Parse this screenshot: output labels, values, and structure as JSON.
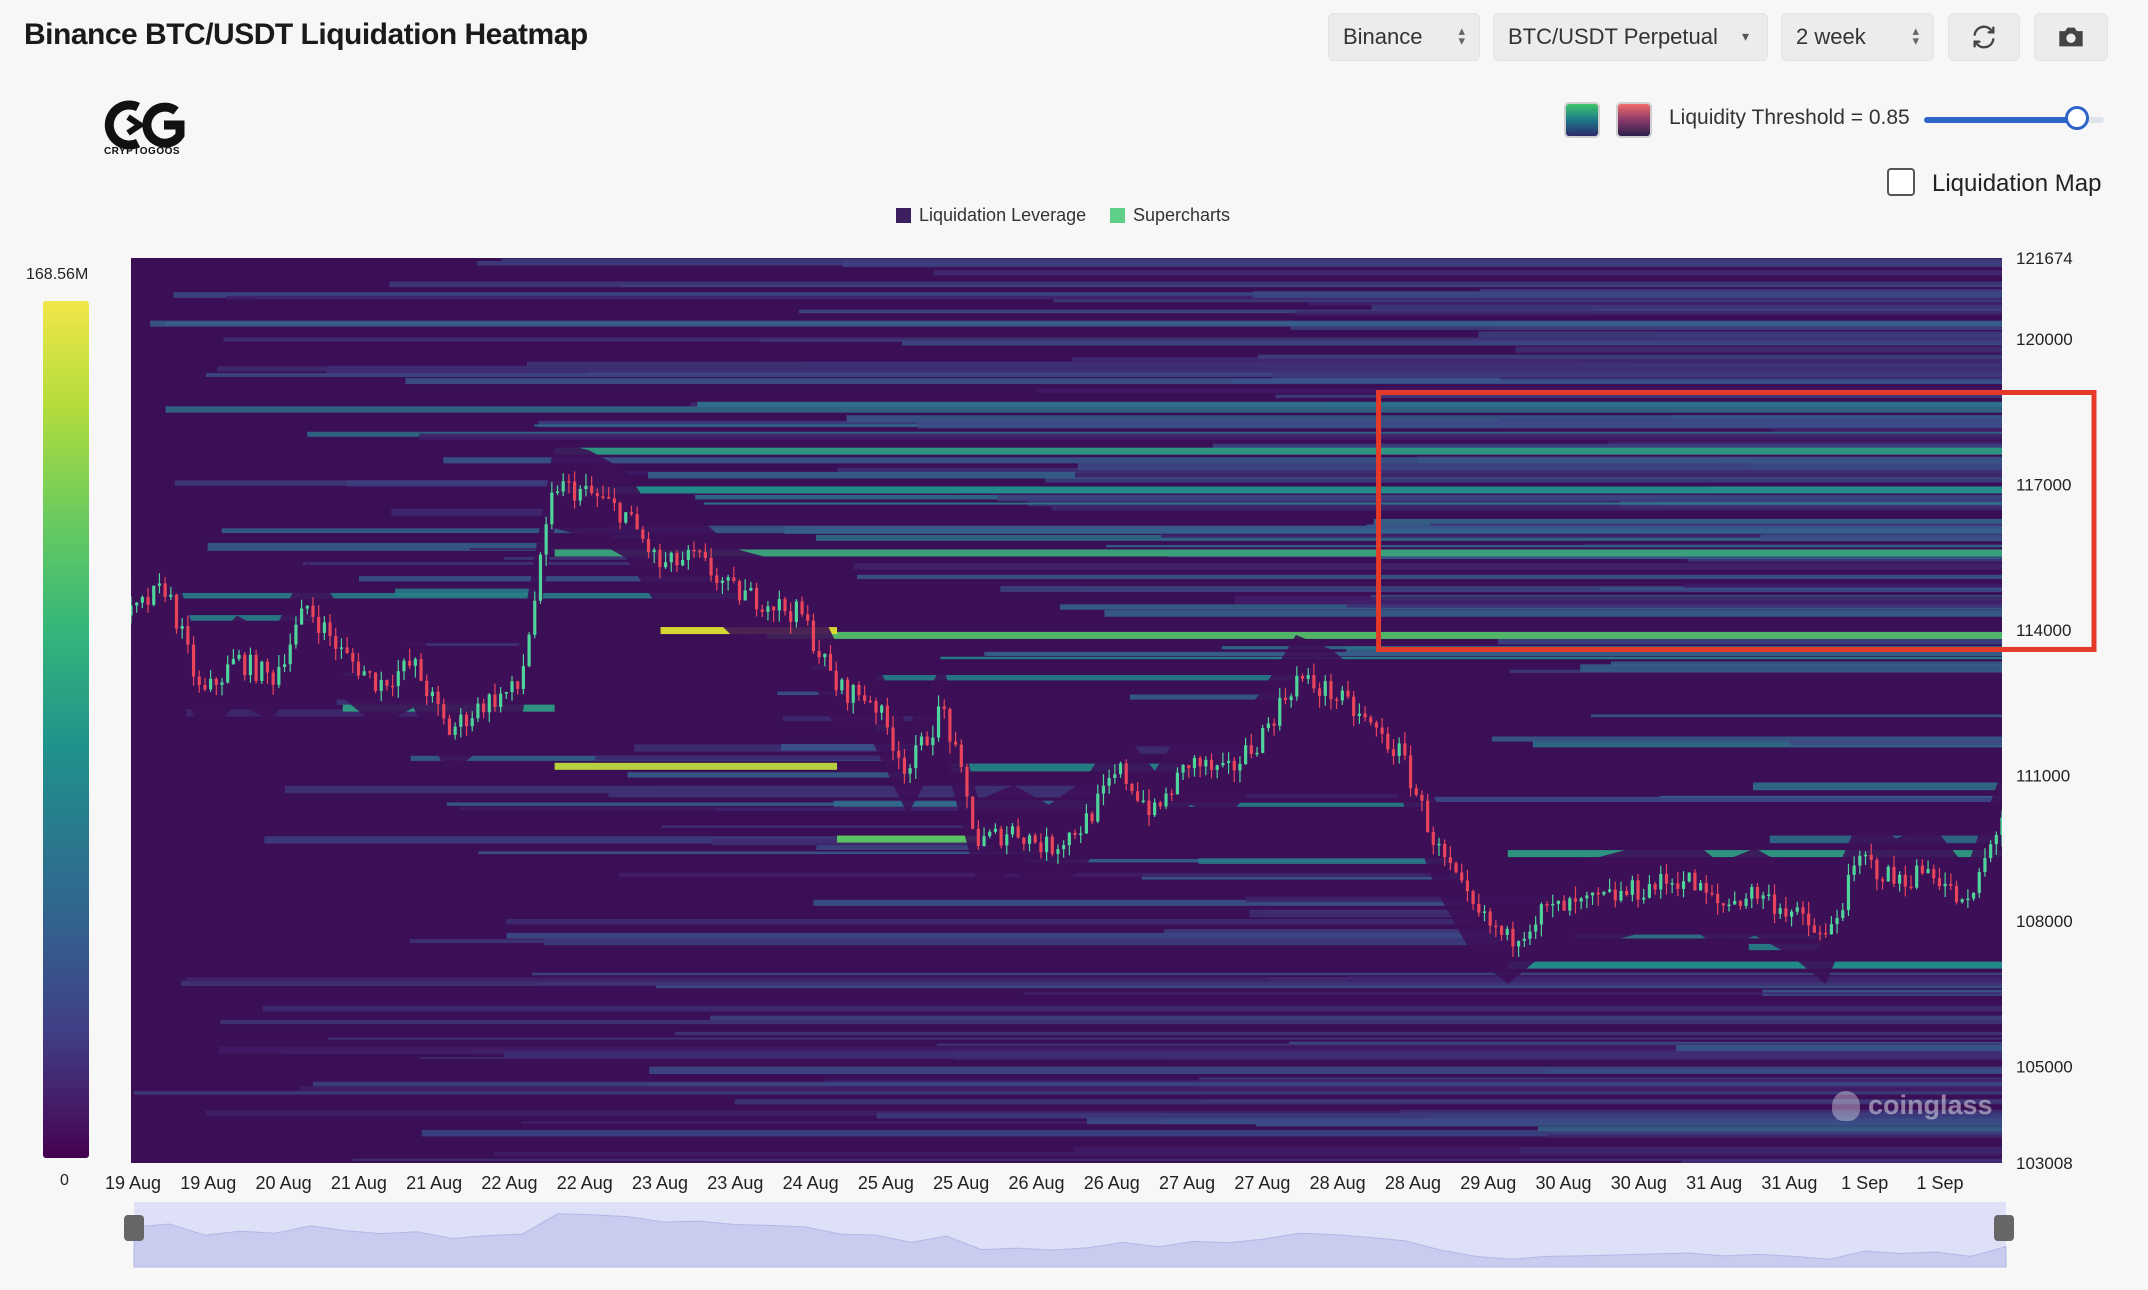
{
  "header": {
    "title": "Binance BTC/USDT Liquidation Heatmap",
    "exchange": "Binance",
    "pair": "BTC/USDT Perpetual",
    "range": "2 week",
    "refresh_icon": "refresh-icon",
    "camera_icon": "camera-icon"
  },
  "logo": {
    "text": "CRYPTOGOOS",
    "mark": "CG"
  },
  "controls": {
    "threshold_label": "Liquidity Threshold = 0.85",
    "threshold_value": 0.85,
    "liquidation_map_label": "Liquidation Map",
    "liquidation_map_checked": false,
    "swatch_colors": [
      "#1f8a6a",
      "#7a3a5a"
    ]
  },
  "legend": {
    "items": [
      {
        "label": "Liquidation Leverage",
        "color": "#3b1f5e"
      },
      {
        "label": "Supercharts",
        "color": "#5fcf8a"
      }
    ]
  },
  "colorbar": {
    "max_label": "168.56M",
    "min_label": "0"
  },
  "watermark": "coinglass",
  "chart_data": {
    "type": "heatmap",
    "title": "Binance BTC/USDT Liquidation Heatmap",
    "x_tick_labels": [
      "19 Aug",
      "19 Aug",
      "20 Aug",
      "21 Aug",
      "21 Aug",
      "22 Aug",
      "22 Aug",
      "23 Aug",
      "23 Aug",
      "24 Aug",
      "25 Aug",
      "25 Aug",
      "26 Aug",
      "26 Aug",
      "27 Aug",
      "27 Aug",
      "28 Aug",
      "28 Aug",
      "29 Aug",
      "30 Aug",
      "30 Aug",
      "31 Aug",
      "31 Aug",
      "1 Sep",
      "1 Sep"
    ],
    "y_tick_labels": [
      "121674",
      "120000",
      "117000",
      "114000",
      "111000",
      "108000",
      "105000",
      "103008"
    ],
    "ylim": [
      103008,
      121674
    ],
    "colorbar_range": [
      "0",
      "168.56M"
    ],
    "price_path": [
      [
        0,
        114300
      ],
      [
        1,
        114900
      ],
      [
        2,
        112600
      ],
      [
        3,
        113400
      ],
      [
        4,
        113000
      ],
      [
        5,
        114500
      ],
      [
        6,
        113500
      ],
      [
        7,
        112900
      ],
      [
        8,
        113300
      ],
      [
        9,
        111900
      ],
      [
        10,
        112500
      ],
      [
        11,
        112800
      ],
      [
        12,
        117000
      ],
      [
        13,
        116800
      ],
      [
        14,
        116400
      ],
      [
        15,
        115300
      ],
      [
        16,
        115500
      ],
      [
        17,
        114800
      ],
      [
        18,
        114600
      ],
      [
        19,
        114300
      ],
      [
        20,
        112800
      ],
      [
        21,
        112600
      ],
      [
        22,
        111100
      ],
      [
        23,
        112400
      ],
      [
        24,
        109600
      ],
      [
        25,
        109900
      ],
      [
        26,
        109500
      ],
      [
        27,
        110000
      ],
      [
        28,
        111100
      ],
      [
        29,
        110200
      ],
      [
        30,
        111300
      ],
      [
        31,
        111000
      ],
      [
        32,
        111800
      ],
      [
        33,
        113000
      ],
      [
        34,
        112700
      ],
      [
        35,
        112100
      ],
      [
        36,
        111400
      ],
      [
        37,
        109500
      ],
      [
        38,
        108200
      ],
      [
        39,
        107600
      ],
      [
        40,
        108200
      ],
      [
        41,
        108300
      ],
      [
        42,
        108500
      ],
      [
        43,
        108700
      ],
      [
        44,
        108900
      ],
      [
        45,
        108300
      ],
      [
        46,
        108600
      ],
      [
        47,
        108200
      ],
      [
        48,
        107600
      ],
      [
        49,
        109300
      ],
      [
        50,
        108800
      ],
      [
        51,
        109100
      ],
      [
        52,
        108200
      ],
      [
        53,
        110200
      ]
    ],
    "bright_bands": [
      {
        "price": 117700,
        "x_from": 12,
        "x_to": 53,
        "intensity": 0.55
      },
      {
        "price": 116900,
        "x_from": 12,
        "x_to": 53,
        "intensity": 0.5
      },
      {
        "price": 115600,
        "x_from": 12,
        "x_to": 53,
        "intensity": 0.6
      },
      {
        "price": 113900,
        "x_from": 18,
        "x_to": 53,
        "intensity": 0.7
      },
      {
        "price": 114000,
        "x_from": 15,
        "x_to": 20,
        "intensity": 0.95
      },
      {
        "price": 111200,
        "x_from": 12,
        "x_to": 20,
        "intensity": 0.9
      },
      {
        "price": 109700,
        "x_from": 20,
        "x_to": 24,
        "intensity": 0.75
      },
      {
        "price": 109400,
        "x_from": 39,
        "x_to": 53,
        "intensity": 0.55
      },
      {
        "price": 107100,
        "x_from": 39,
        "x_to": 53,
        "intensity": 0.5
      },
      {
        "price": 112400,
        "x_from": 6,
        "x_to": 12,
        "intensity": 0.55
      }
    ],
    "annotation": {
      "type": "rectangle",
      "color": "#e53a2a",
      "y_range": [
        113600,
        118900
      ],
      "x_from": 35,
      "x_to": 53
    }
  }
}
